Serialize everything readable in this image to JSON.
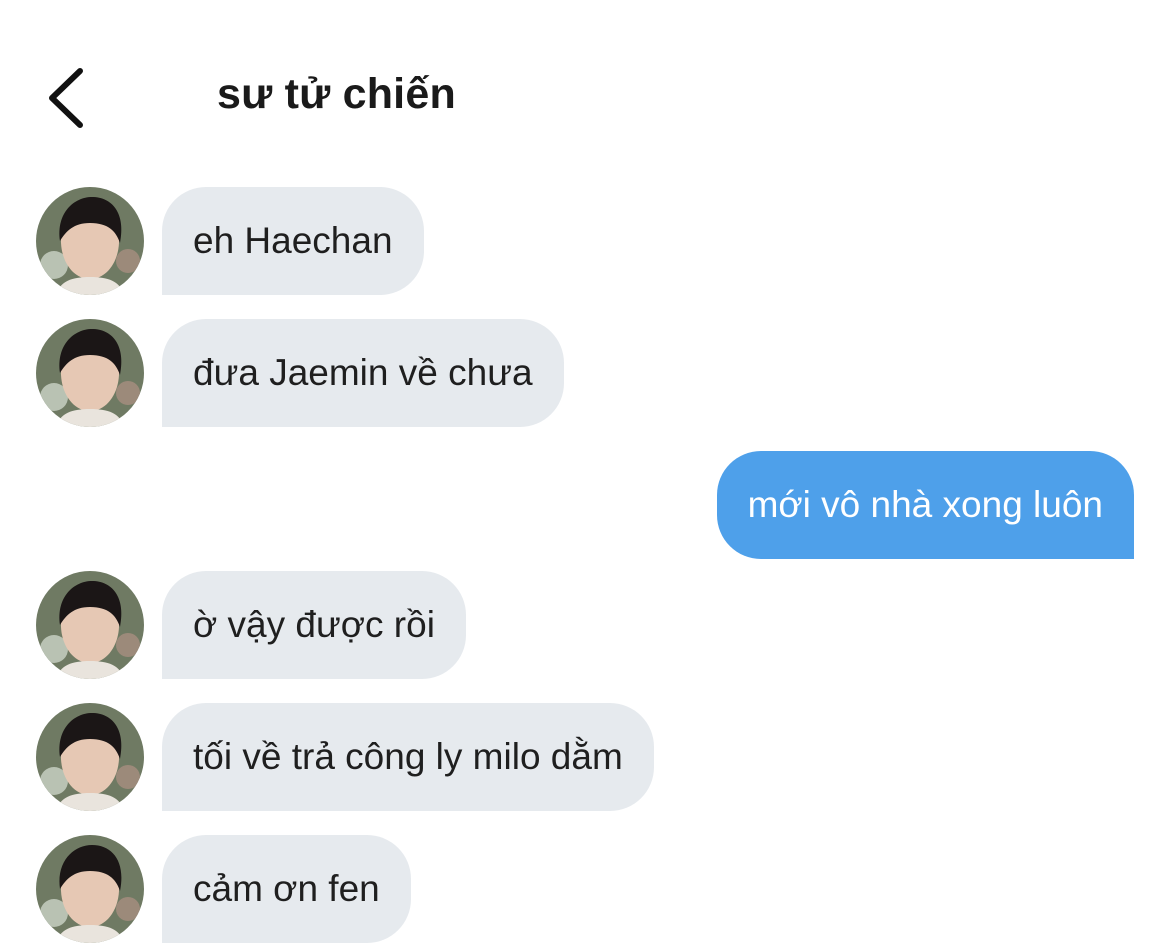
{
  "header": {
    "back_icon": "chevron-left-icon",
    "title": "sư tử chiến"
  },
  "messages": [
    {
      "sender": "contact",
      "text": "eh Haechan"
    },
    {
      "sender": "contact",
      "text": "đưa Jaemin về chưa"
    },
    {
      "sender": "me",
      "text": "mới vô nhà xong luôn"
    },
    {
      "sender": "contact",
      "text": "ờ vậy được rồi"
    },
    {
      "sender": "contact",
      "text": "tối về trả công ly milo dằm"
    },
    {
      "sender": "contact",
      "text": "cảm ơn fen"
    }
  ],
  "colors": {
    "incoming_bubble": "#e6eaee",
    "outgoing_bubble": "#4ea0ea",
    "outgoing_text": "#ffffff",
    "background": "#ffffff"
  }
}
